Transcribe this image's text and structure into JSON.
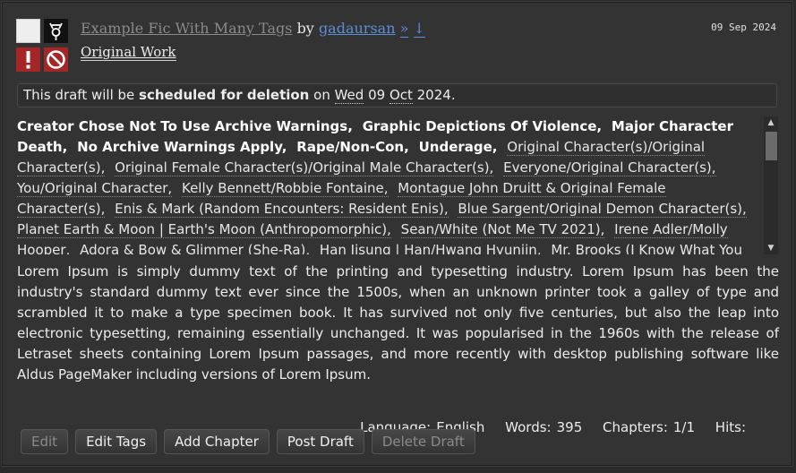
{
  "work": {
    "title": "Example Fic With Many Tags",
    "by": "by",
    "author": "gadaursan",
    "gift_arrow": "»",
    "down_arrow": "↓",
    "fandom": "Original Work",
    "date": "09 Sep 2024"
  },
  "notice": {
    "prefix": "This draft will be ",
    "emphasis": "scheduled for deletion",
    "on": " on ",
    "weekday": "Wed",
    "day": " 09 ",
    "month": "Oct",
    "year": " 2024."
  },
  "tags": {
    "warnings": [
      "Creator Chose Not To Use Archive Warnings,",
      "Graphic Depictions Of Violence,",
      "Major Character Death,",
      "No Archive Warnings Apply,",
      "Rape/Non-Con,",
      "Underage,"
    ],
    "relationships": [
      "Original Character(s)/Original Character(s),",
      "Original Female Character(s)/Original Male Character(s),",
      "Everyone/Original Character(s),",
      "You/Original Character,",
      "Kelly Bennett/Robbie Fontaine,",
      "Montague John Druitt & Original Female Character(s),",
      "Enis & Mark (Random Encounters: Resident Enis),",
      "Blue Sargent/Original Demon Character(s),",
      "Planet Earth & Moon | Earth's Moon (Anthropomorphic),",
      "Sean/White (Not Me TV 2021),",
      "Irene Adler/Molly Hooper,",
      "Adora & Bow & Glimmer (She-Ra),",
      "Han Jisung | Han/Hwang Hyunjin,",
      "Mr. Brooks (I Know What You Did Last Summer)/Original Character(s),"
    ]
  },
  "summary": "Lorem Ipsum is simply dummy text of the printing and typesetting industry. Lorem Ipsum has been the industry's standard dummy text ever since the 1500s, when an unknown printer took a galley of type and scrambled it to make a type specimen book. It has survived not only five centuries, but also the leap into electronic typesetting, remaining essentially unchanged. It was popularised in the 1960s with the release of Letraset sheets containing Lorem Ipsum passages, and more recently with desktop publishing software like Aldus PageMaker including versions of Lorem Ipsum.",
  "stats": {
    "language_label": "Language:",
    "language": "English",
    "words_label": "Words:",
    "words": "395",
    "chapters_label": "Chapters:",
    "chapters": "1/1",
    "hits_label": "Hits:",
    "hits": ""
  },
  "actions": {
    "edit": "Edit",
    "edit_tags": "Edit Tags",
    "add_chapter": "Add Chapter",
    "post_draft": "Post Draft",
    "delete_draft": "Delete Draft"
  },
  "scrollbar": {
    "up": "▲",
    "down": "▼"
  },
  "icons": {
    "rating": "rating-not-rated-icon",
    "category": "category-multi-icon",
    "warning": "warning-exclamation-icon",
    "complete": "no-symbol-icon"
  },
  "colors": {
    "background": "#333333",
    "link": "#5a8fd8",
    "warning_red": "#a52626"
  }
}
